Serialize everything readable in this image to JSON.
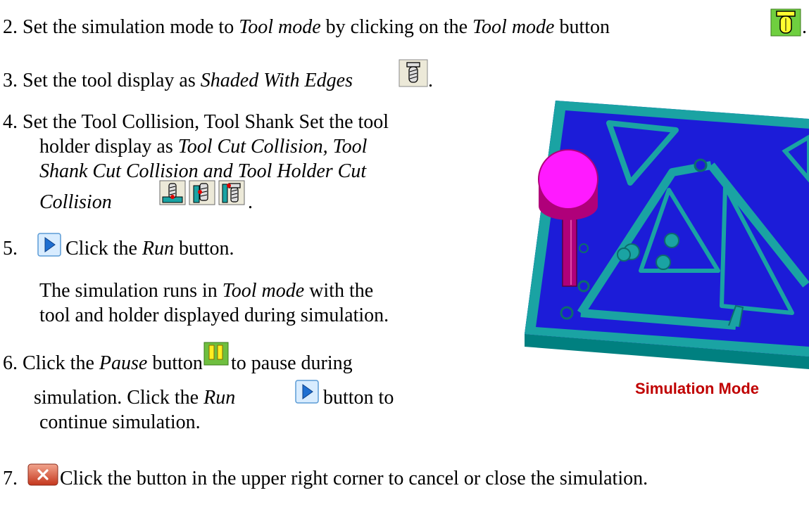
{
  "steps": {
    "s2": {
      "num": "2.",
      "a": "Set the simulation mode to ",
      "b": "Tool mode",
      "c": " by clicking on the ",
      "d": "Tool mode",
      "e": " button",
      "f": "."
    },
    "s3": {
      "num": "3.",
      "a": "Set the tool display as ",
      "b": "Shaded With Edges",
      "c": "."
    },
    "s4": {
      "num": "4.",
      "l1": "Set the Tool Collision, Tool Shank Set the tool",
      "l2a": "holder display as ",
      "l2b": "Tool Cut Collision, Tool",
      "l3": "Shank Cut Collision and Tool Holder Cut",
      "l4": "Collision",
      "end": "."
    },
    "s5": {
      "num": "5.",
      "a": "Click the ",
      "b": "Run",
      "c": " button.",
      "p1a": "The simulation runs in ",
      "p1b": "Tool mode",
      "p1c": " with the",
      "p2": "tool and holder displayed during simulation."
    },
    "s6": {
      "num": "6.",
      "a": "Click the ",
      "b": "Pause",
      "c": " button ",
      "d": " to pause during",
      "l2a": "simulation. Click the ",
      "l2b": "Run",
      "l2c": " button to",
      "l3": "continue simulation."
    },
    "s7": {
      "num": "7.",
      "a": " Click the button in the upper right corner to cancel or close the simulation."
    }
  },
  "figure": {
    "caption": "Simulation Mode"
  },
  "colors": {
    "caption": "#c00000",
    "stock_top": "#1c1cd8",
    "stock_side": "#008080",
    "features": "#1aa3a3",
    "tool": "#ff1aff",
    "shank": "#b0007a"
  },
  "icons": [
    "tool-mode-icon",
    "shaded-with-edges-icon",
    "tool-cut-collision-icon",
    "tool-shank-cut-collision-icon",
    "tool-holder-cut-collision-icon",
    "run-icon",
    "pause-icon",
    "close-icon"
  ]
}
